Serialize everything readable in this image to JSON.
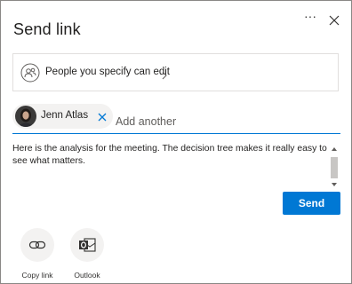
{
  "dialog": {
    "title": "Send link",
    "more_icon": "more-options-icon",
    "close_icon": "close-icon"
  },
  "permission": {
    "label": "People you specify can edit",
    "icon": "people-icon",
    "chevron_icon": "chevron-right-icon"
  },
  "recipients": {
    "chips": [
      {
        "name": "Jenn Atlas",
        "avatar": "avatar-photo",
        "remove_icon": "remove-icon"
      }
    ],
    "input_placeholder": "Add another"
  },
  "message": {
    "text": "Here is the analysis for the meeting.  The decision tree makes it really easy to see what matters."
  },
  "send_button": {
    "label": "Send"
  },
  "share_options": [
    {
      "label": "Copy link",
      "icon": "link-icon"
    },
    {
      "label": "Outlook",
      "icon": "outlook-icon"
    }
  ],
  "colors": {
    "accent": "#0078d4",
    "chip_bg": "#f3f2f1",
    "border": "#e1dfdd"
  }
}
